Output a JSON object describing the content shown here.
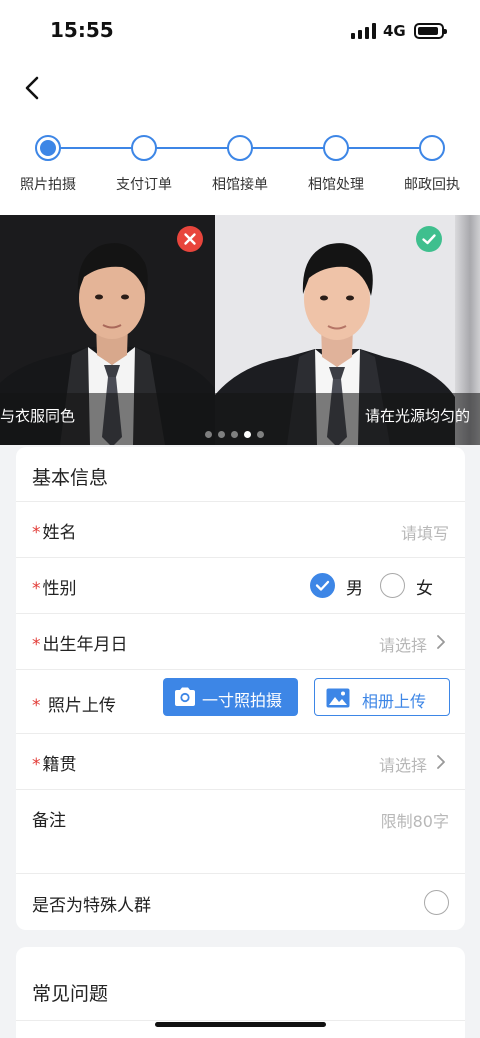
{
  "status_bar": {
    "time": "15:55",
    "network": "4G"
  },
  "steps": [
    "照片拍摄",
    "支付订单",
    "相馆接单",
    "相馆处理",
    "邮政回执"
  ],
  "carousel": {
    "captions": [
      "与衣服同色",
      "请在光源均匀的"
    ],
    "active_index": 3,
    "dot_count": 5
  },
  "basic_info": {
    "title": "基本信息",
    "required_mark": "*",
    "name": {
      "label": "姓名",
      "placeholder": "请填写"
    },
    "gender": {
      "label": "性别",
      "male": "男",
      "female": "女",
      "selected": "男"
    },
    "birth": {
      "label": "出生年月日",
      "placeholder": "请选择"
    },
    "photo": {
      "label": "照片上传",
      "shoot_button": "一寸照拍摄",
      "album_button": "相册上传"
    },
    "origin": {
      "label": "籍贯",
      "placeholder": "请选择"
    },
    "remark": {
      "label": "备注",
      "placeholder": "限制80字"
    },
    "special": {
      "label": "是否为特殊人群"
    }
  },
  "faq": {
    "title": "常见问题"
  },
  "colors": {
    "accent": "#3d86e6",
    "required": "#e23b36",
    "reject": "#e8453c",
    "approve": "#3fbf8e"
  }
}
